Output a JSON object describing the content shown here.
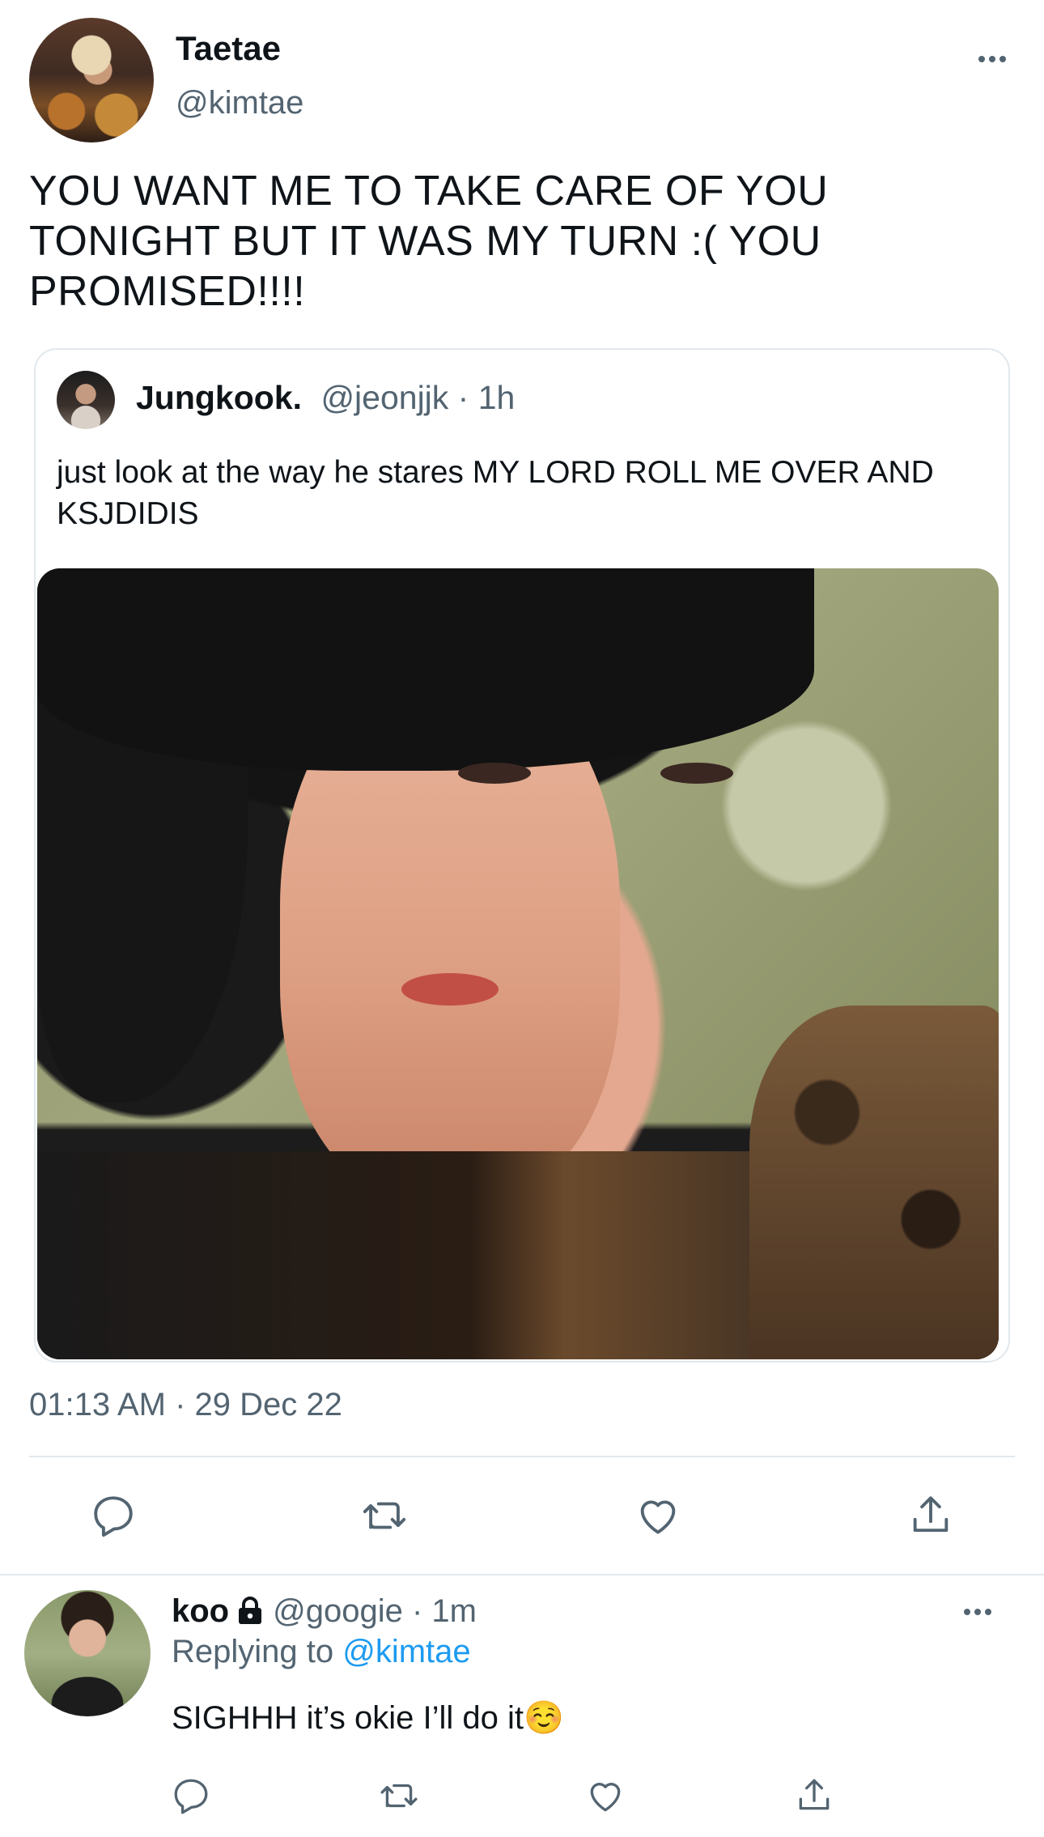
{
  "main_tweet": {
    "display_name": "Taetae",
    "handle": "@kimtae",
    "text": "YOU WANT ME TO TAKE CARE OF YOU TONIGHT BUT IT WAS MY TURN :( YOU PROMISED!!!!",
    "timestamp": "01:13 AM · 29 Dec 22"
  },
  "quoted_tweet": {
    "display_name": "Jungkook.",
    "meta": "@jeonjjk · 1h",
    "text": "just look at the way he stares MY LORD ROLL ME OVER AND KSJDIDIS"
  },
  "reply": {
    "display_name": "koo",
    "meta": "@googie · 1m",
    "replying_prefix": "Replying to ",
    "replying_mention": "@kimtae",
    "text": "SIGHHH it’s okie I’ll do it☺️"
  },
  "icons": {
    "reply": "reply-icon",
    "retweet": "retweet-icon",
    "like": "heart-icon",
    "share": "share-icon",
    "more": "more-dots-icon",
    "lock": "lock-icon"
  },
  "colors": {
    "text_primary": "#0f1419",
    "text_secondary": "#536471",
    "link": "#1d9bf0",
    "border": "#e1e8ed"
  }
}
